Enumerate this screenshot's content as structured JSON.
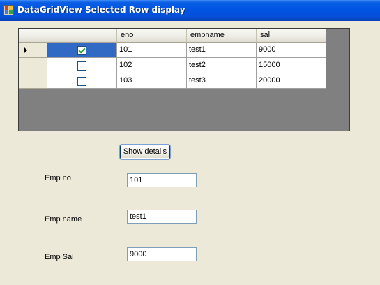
{
  "window": {
    "title": "DataGridView Selected Row display",
    "icon": "app-window-icon"
  },
  "grid": {
    "columns": [
      "",
      "eno",
      "empname",
      "sal"
    ],
    "rows": [
      {
        "checked": true,
        "eno": "101",
        "empname": "test1",
        "sal": "9000",
        "selected": true
      },
      {
        "checked": false,
        "eno": "102",
        "empname": "test2",
        "sal": "15000",
        "selected": false
      },
      {
        "checked": false,
        "eno": "103",
        "empname": "test3",
        "sal": "20000",
        "selected": false
      }
    ],
    "colors": {
      "selection": "#316ac5",
      "empty_area": "#808080"
    }
  },
  "show_details_label": "Show details",
  "form": {
    "emp_no_label": "Emp no",
    "emp_no_value": "101",
    "emp_name_label": "Emp name",
    "emp_name_value": "test1",
    "emp_sal_label": "Emp Sal",
    "emp_sal_value": "9000"
  }
}
